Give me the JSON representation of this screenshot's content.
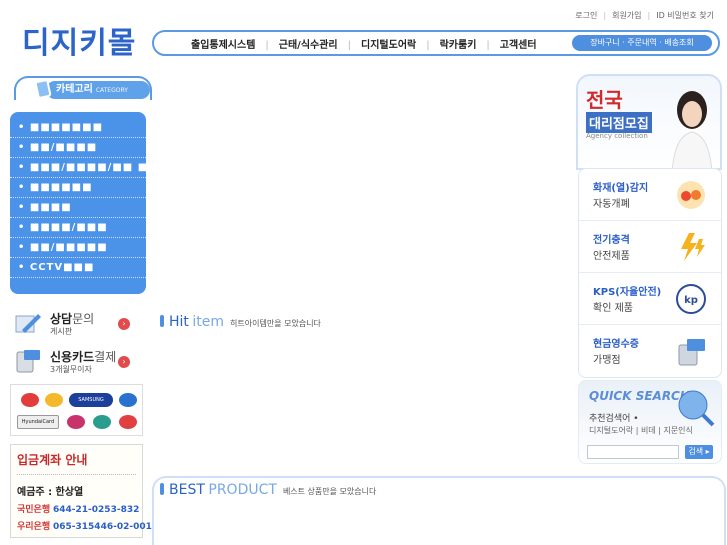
{
  "logo": "디지키몰",
  "top_links": [
    "로그인",
    "회원가입",
    "ID 비밀번호 찾기"
  ],
  "nav": {
    "items": [
      "출입통제시스템",
      "근태/식수관리",
      "디지털도어락",
      "락카룸키",
      "고객센터"
    ],
    "pill": "장바구니 · 주문내역 · 배송조회"
  },
  "category": {
    "title": "카테고리",
    "title_en": "CATEGORY",
    "items": [
      "• ■■■■■■■",
      "• ■■/■■■■",
      "• ■■■/■■■■/■■ ■",
      "• ■■■■■■",
      "• ■■■■",
      "• ■■■■/■■■",
      "• ■■/■■■■■",
      "• CCTV■■■"
    ]
  },
  "consult": {
    "title": "상담",
    "title2": "문의",
    "sub": "게시판"
  },
  "card_pay": {
    "title": "신용카드",
    "title2": "결제",
    "sub": "3개월무이자"
  },
  "card_logos": {
    "samsung": "SAMSUNG",
    "hyundai": "HyundaiCard"
  },
  "bank": {
    "title": "입금계좌 안내",
    "holder": "예금주 : 한상열",
    "rows": [
      {
        "bank": "국민은행",
        "number": "644-21-0253-832"
      },
      {
        "bank": "우리은행",
        "number": "065-315446-02-001"
      }
    ]
  },
  "hit": {
    "t1": "Hit",
    "t2": "item",
    "sub": "히트아이템만을 모았습니다"
  },
  "best": {
    "t1": "BEST",
    "t2": "PRODUCT",
    "sub": "베스트 상품만을 모았습니다"
  },
  "agency": {
    "t1": "전국",
    "t2": "대리점모집",
    "t3": "Agency collection"
  },
  "features": [
    {
      "title": "화재(열)감지",
      "sub": "자동개폐"
    },
    {
      "title": "전기충격",
      "sub": "안전제품"
    },
    {
      "title": "KPS(자율안전)",
      "sub": "확인 제품"
    },
    {
      "title": "현금영수증",
      "sub": "가맹점"
    }
  ],
  "kps_badge": "kp",
  "quick_search": {
    "title": "QUICK SEARCH",
    "label": "추천검색어 •",
    "keywords": "디지털도어락 | 비데 | 지문인식",
    "button": "검색 ▸"
  },
  "colors": {
    "accent": "#4f8fdf",
    "category_bg": "#4a93e8",
    "red": "#d22a2a"
  }
}
